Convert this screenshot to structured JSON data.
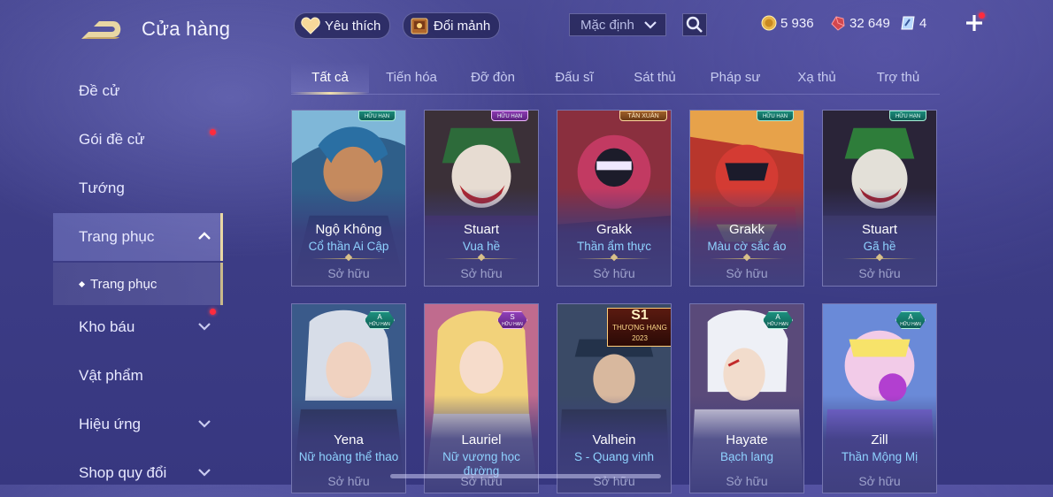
{
  "header": {
    "title": "Cửa hàng",
    "favorites_label": "Yêu thích",
    "exchange_label": "Đổi mảnh",
    "sort_selected": "Mặc định",
    "currencies": [
      {
        "icon": "gold-coin-icon",
        "value": "5 936"
      },
      {
        "icon": "red-gem-icon",
        "value": "32 649"
      },
      {
        "icon": "voucher-icon",
        "value": "4"
      }
    ]
  },
  "sidebar": {
    "items": [
      {
        "label": "Đề cử"
      },
      {
        "label": "Gói đề cử"
      },
      {
        "label": "Tướng"
      },
      {
        "label": "Trang phục"
      },
      {
        "label": "Kho báu"
      },
      {
        "label": "Vật phẩm"
      },
      {
        "label": "Hiệu ứng"
      },
      {
        "label": "Shop quy đổi"
      }
    ],
    "sub_item": "Trang phục"
  },
  "tabs": [
    "Tất cả",
    "Tiến hóa",
    "Đỡ đòn",
    "Đấu sĩ",
    "Sát thủ",
    "Pháp sư",
    "Xạ thủ",
    "Trợ thủ"
  ],
  "active_tab": "Tất cả",
  "cards": [
    {
      "hero": "Ngộ Không",
      "skin": "Cổ thần Ai Cập",
      "status": "Sở hữu",
      "badge": "HỮU HẠN"
    },
    {
      "hero": "Stuart",
      "skin": "Vua hề",
      "status": "Sở hữu",
      "badge": "HỮU HẠN"
    },
    {
      "hero": "Grakk",
      "skin": "Thần ẩm thực",
      "status": "Sở hữu",
      "badge": "TÂN XUÂN"
    },
    {
      "hero": "Grakk",
      "skin": "Màu cờ sắc áo",
      "status": "Sở hữu",
      "badge": "HỮU HẠN"
    },
    {
      "hero": "Stuart",
      "skin": "Gã hề",
      "status": "Sở hữu",
      "badge": "HỮU HẠN"
    },
    {
      "hero": "Yena",
      "skin": "Nữ hoàng thể thao",
      "status": "Sở hữu",
      "grade": "A",
      "badge": "HỮU HẠN"
    },
    {
      "hero": "Lauriel",
      "skin": "Nữ vương học đường",
      "status": "Sở hữu",
      "grade": "S",
      "badge": "HỮU HẠN"
    },
    {
      "hero": "Valhein",
      "skin": "S - Quang vinh",
      "status": "Sở hữu",
      "season_top": "S1",
      "season_mid": "THƯỢNG HẠNG",
      "season_year": "2023"
    },
    {
      "hero": "Hayate",
      "skin": "Bạch lang",
      "status": "Sở hữu",
      "grade": "A",
      "badge": "HỮU HẠN"
    },
    {
      "hero": "Zill",
      "skin": "Thần Mộng Mị",
      "status": "Sở hữu",
      "grade": "A",
      "badge": "HỮU HẠN"
    }
  ],
  "colors": {
    "background": "#3d3d86",
    "accent_gold": "#e8d7a4",
    "skin_text": "#8fd2ff",
    "owned_text": "#9ea2cc",
    "notification": "#ff2b3d"
  }
}
